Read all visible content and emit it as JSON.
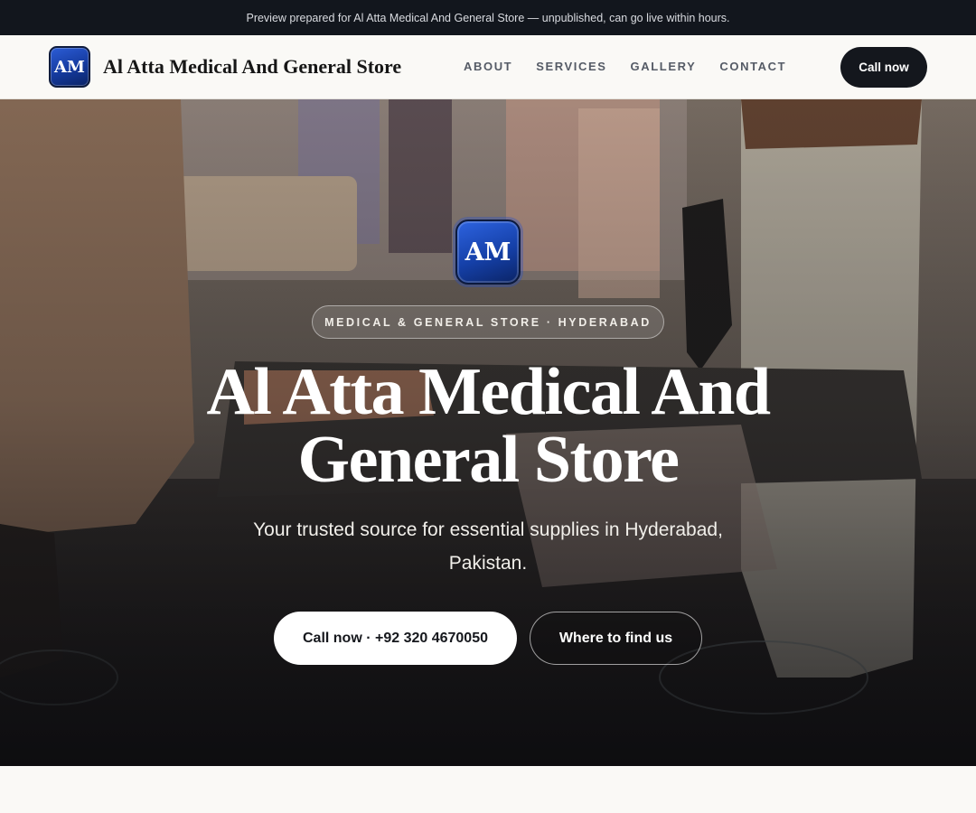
{
  "preview_bar": {
    "text": "Preview prepared for Al Atta Medical And General Store — unpublished, can go live within hours."
  },
  "header": {
    "logo_text": "AM",
    "brand_name": "Al Atta Medical And General Store",
    "nav": [
      "ABOUT",
      "SERVICES",
      "GALLERY",
      "CONTACT"
    ],
    "cta_label": "Call now"
  },
  "hero": {
    "logo_text": "AM",
    "tagline": "MEDICAL & GENERAL STORE · HYDERABAD",
    "title": "Al Atta Medical And General Store",
    "subtitle": "Your trusted source for essential supplies in Hyderabad, Pakistan.",
    "primary_button": "Call now · +92 320 4670050",
    "secondary_button": "Where to find us",
    "background_image": "clothing-store-interior-photo"
  },
  "colors": {
    "dark_bar": "#12161d",
    "page_bg": "#faf9f6",
    "logo_blue": "#1540a8",
    "cta_dark": "#14171d"
  }
}
